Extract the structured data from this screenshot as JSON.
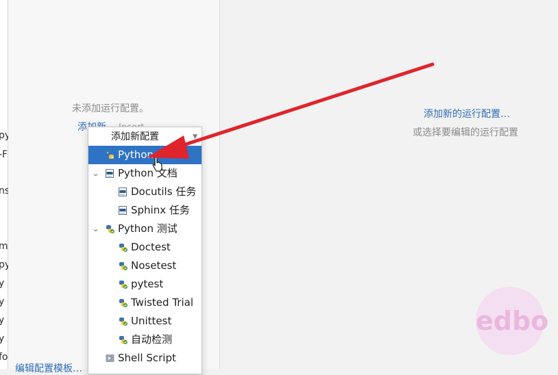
{
  "left_strip": {
    "fragments": [
      "py",
      "-F",
      "ns",
      "m",
      "py",
      "y",
      "y",
      "y",
      "y",
      "fo"
    ]
  },
  "left_pane": {
    "empty_text": "未添加运行配置。",
    "add_new_label": "添加新…",
    "add_new_shortcut": "Insert",
    "edit_templates": "编辑配置模板…"
  },
  "right_pane": {
    "add_new_link": "添加新的运行配置…",
    "or_select_text": "或选择要编辑的运行配置"
  },
  "popup": {
    "header": "添加新配置",
    "items": [
      {
        "label": "Python",
        "icon": "python-icon",
        "selected": true
      },
      {
        "label": "Python 文档",
        "icon": "rst-icon",
        "expanded": true
      },
      {
        "label": "Docutils 任务",
        "icon": "rst-icon"
      },
      {
        "label": "Sphinx 任务",
        "icon": "rst-icon"
      },
      {
        "label": "Python 测试",
        "icon": "python-test-icon",
        "expanded": true
      },
      {
        "label": "Doctest",
        "icon": "python-test-icon"
      },
      {
        "label": "Nosetest",
        "icon": "python-test-icon"
      },
      {
        "label": "pytest",
        "icon": "python-test-icon"
      },
      {
        "label": "Twisted Trial",
        "icon": "python-test-icon"
      },
      {
        "label": "Unittest",
        "icon": "python-test-icon"
      },
      {
        "label": "自动检测",
        "icon": "python-test-icon"
      },
      {
        "label": "Shell Script",
        "icon": "shell-script-icon"
      }
    ]
  },
  "colors": {
    "link": "#2f6db5",
    "selection": "#2f73c4",
    "annotation_arrow": "#e0242c"
  }
}
